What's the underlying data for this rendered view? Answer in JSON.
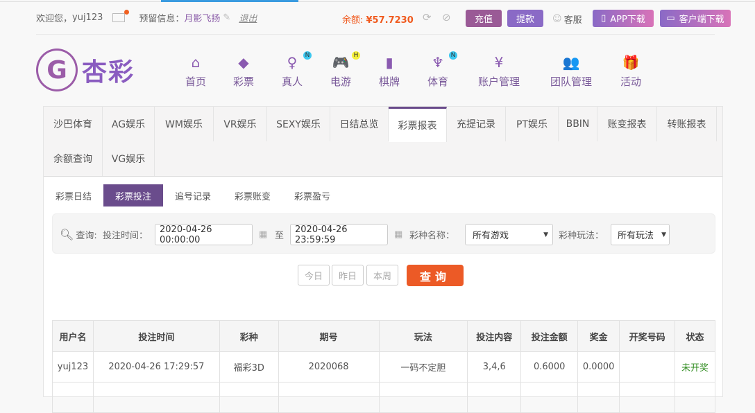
{
  "topbar": {
    "welcome": "欢迎您，",
    "username": "yuj123",
    "reserve_label": "预留信息：",
    "reserve_value": "月影飞扬",
    "logout": "退出",
    "balance_label": "余额: ",
    "balance_value": "¥57.7230",
    "deposit": "充值",
    "withdraw": "提款",
    "service": "客服",
    "app_download": "APP下载",
    "client_download": "客户端下载"
  },
  "logo": {
    "text": "杏彩"
  },
  "nav": [
    {
      "label": "首页"
    },
    {
      "label": "彩票"
    },
    {
      "label": "真人",
      "badge": "N"
    },
    {
      "label": "电游",
      "badge": "H"
    },
    {
      "label": "棋牌"
    },
    {
      "label": "体育",
      "badge": "N"
    },
    {
      "label": "账户管理"
    },
    {
      "label": "团队管理"
    },
    {
      "label": "活动"
    }
  ],
  "tabs": [
    "沙巴体育",
    "AG娱乐",
    "WM娱乐",
    "VR娱乐",
    "SEXY娱乐",
    "日结总览",
    "彩票报表",
    "充提记录",
    "PT娱乐",
    "BBIN",
    "账变报表",
    "转账报表",
    "余额查询",
    "VG娱乐"
  ],
  "subtabs": [
    "彩票日结",
    "彩票投注",
    "追号记录",
    "彩票账变",
    "彩票盈亏"
  ],
  "filter": {
    "query_label": "查询:",
    "time_label": "投注时间：",
    "start": "2020-04-26 00:00:00",
    "to": "至",
    "end": "2020-04-26 23:59:59",
    "lottery_label": "彩种名称：",
    "lottery_value": "所有游戏",
    "play_label": "彩种玩法：",
    "play_value": "所有玩法"
  },
  "quick": {
    "today": "今日",
    "yesterday": "昨日",
    "week": "本周",
    "search": "查询"
  },
  "table": {
    "headers": [
      "用户名",
      "投注时间",
      "彩种",
      "期号",
      "玩法",
      "投注内容",
      "投注金额",
      "奖金",
      "开奖号码",
      "状态"
    ],
    "rows": [
      [
        "yuj123",
        "2020-04-26 17:29:57",
        "福彩3D",
        "2020068",
        "一码不定胆",
        "3,4,6",
        "0.6000",
        "0.0000",
        "",
        "未开奖"
      ]
    ]
  },
  "colors": {
    "primary": "#6a4c8c",
    "accent": "#ec5a26",
    "status_green": "#2e8b1e"
  }
}
